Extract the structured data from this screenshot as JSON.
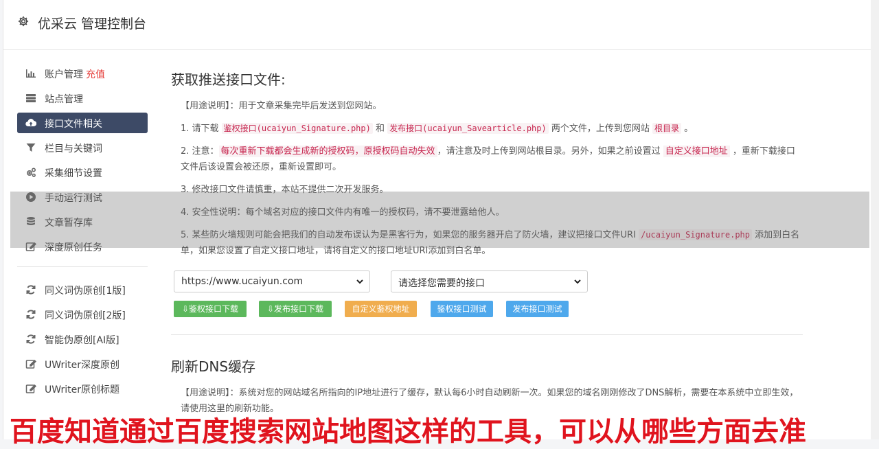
{
  "header": {
    "title": "优采云 管理控制台",
    "icon": "gear-icon"
  },
  "sidebar": {
    "group1": [
      {
        "label": "账户管理",
        "badge": "充值",
        "icon": "bar-chart-icon"
      },
      {
        "label": "站点管理",
        "icon": "server-icon"
      },
      {
        "label": "接口文件相关",
        "icon": "cloud-upload-icon",
        "active": true
      },
      {
        "label": "栏目与关键词",
        "icon": "filter-icon"
      },
      {
        "label": "采集细节设置",
        "icon": "gears-icon"
      },
      {
        "label": "手动运行测试",
        "icon": "play-circle-icon"
      },
      {
        "label": "文章暂存库",
        "icon": "database-icon"
      },
      {
        "label": "深度原创任务",
        "icon": "edit-icon"
      }
    ],
    "group2": [
      {
        "label": "同义词伪原创[1版]",
        "icon": "refresh-icon"
      },
      {
        "label": "同义词伪原创[2版]",
        "icon": "refresh-icon"
      },
      {
        "label": "智能伪原创[AI版]",
        "icon": "refresh-icon"
      },
      {
        "label": "UWriter深度原创",
        "icon": "edit-icon"
      },
      {
        "label": "UWriter原创标题",
        "icon": "edit-icon"
      }
    ]
  },
  "section1": {
    "title": "获取推送接口文件:",
    "usage": "【用途说明】：用于文章采集完毕后发送到您网站。",
    "p1": {
      "a": "1. 请下载 ",
      "code1": "鉴权接口(ucaiyun_Signature.php)",
      "b": " 和 ",
      "code2": "发布接口(ucaiyun_Savearticle.php)",
      "c": " 两个文件，上传到您网站 ",
      "code3": "根目录",
      "d": " 。"
    },
    "p2": {
      "a": "2. 注意：",
      "code1": "每次重新下载都会生成新的授权码，原授权码自动失效",
      "b": "，请注意及时上传到网站根目录。另外，如果之前设置过 ",
      "code2": "自定义接口地址",
      "c": " ，重新下载接口文件后该设置会被还原，重新设置即可。"
    },
    "p3": "3. 修改接口文件请慎重，本站不提供二次开发服务。",
    "p4": "4. 安全性说明：每个域名对应的接口文件内有唯一的授权码，请不要泄露给他人。",
    "p5": {
      "a": "5. 某些防火墙规则可能会把我们的自动发布误认为是黑客行为，如果您的服务器开启了防火墙，建议把接口文件URI ",
      "code1": "/ucaiyun_Signature.php",
      "b": " 添加到白名单，如果您设置了自定义接口地址，请将自定义的接口地址URI添加到白名单。"
    },
    "select_site": "https://www.ucaiyun.com",
    "select_api": "请选择您需要的接口",
    "buttons": {
      "auth_download": "鉴权接口下载",
      "publish_download": "发布接口下载",
      "custom_auth": "自定义鉴权地址",
      "auth_test": "鉴权接口测试",
      "publish_test": "发布接口测试"
    }
  },
  "section2": {
    "title": "刷新DNS缓存",
    "usage": "【用途说明】：系统对您的网站域名所指向的IP地址进行了缓存，默认每6小时自动刷新一次。如果您的域名刚刚修改了DNS解析，需要在本系统中立即生效，请使用这里的刷新功能。"
  },
  "overlay_text": "百度知道通过百度搜索网站地图这样的工具，可以从哪些方面去准"
}
